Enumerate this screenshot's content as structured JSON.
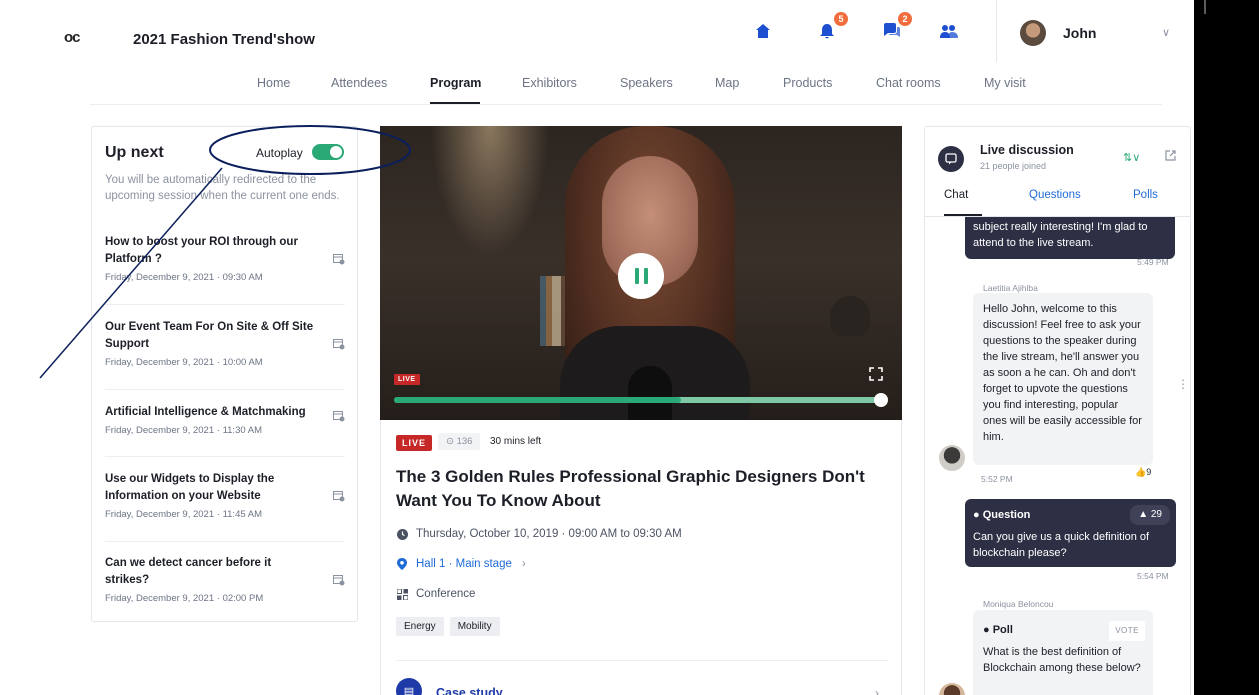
{
  "app": {
    "logo": "oc",
    "event_title": "2021 Fashion Trend'show"
  },
  "header": {
    "icons": [
      {
        "name": "home-icon"
      },
      {
        "name": "bell-icon",
        "badge": "5"
      },
      {
        "name": "chat-icon",
        "badge": "2"
      },
      {
        "name": "people-icon"
      }
    ],
    "user_name": "John"
  },
  "nav": {
    "items": [
      "Home",
      "Attendees",
      "Program",
      "Exhibitors",
      "Speakers",
      "Map",
      "Products",
      "Chat rooms",
      "My visit"
    ],
    "active": "Program"
  },
  "upnext": {
    "title": "Up next",
    "autoplay_label": "Autoplay",
    "autoplay_on": true,
    "description": "You will be automatically redirected to the upcoming session when the current one ends.",
    "sessions": [
      {
        "title": "How to boost your ROI through our Platform ?",
        "date": "Friday, December 9, 2021 · 09:30 AM"
      },
      {
        "title": "Our Event Team For On Site & Off Site Support",
        "date": "Friday, December 9, 2021 · 10:00 AM"
      },
      {
        "title": "Artificial Intelligence & Matchmaking",
        "date": "Friday, December 9, 2021 · 11:30 AM"
      },
      {
        "title": "Use our Widgets to Display the Information on your Website",
        "date": "Friday, December 9, 2021 · 11:45 AM"
      },
      {
        "title": "Can we detect cancer before it strikes?",
        "date": "Friday, December 9, 2021 · 02:00 PM"
      }
    ]
  },
  "video": {
    "live_label": "LIVE",
    "progress": 0.59
  },
  "session": {
    "live_tag": "LIVE",
    "views": "136",
    "time_left": "30 mins left",
    "title": "The 3 Golden Rules Professional Graphic Designers Don't Want You To Know About",
    "datetime": "Thursday, October 10, 2019 · 09:00 AM to 09:30 AM",
    "location": "Hall 1 · Main stage",
    "type": "Conference",
    "tags": [
      "Energy",
      "Mobility"
    ],
    "case_study_label": "Case study"
  },
  "discussion": {
    "title": "Live discussion",
    "subtitle": "21 people joined",
    "tabs": [
      "Chat",
      "Questions",
      "Polls"
    ],
    "active_tab": "Chat",
    "messages": {
      "m1_text": "subject really interesting! I'm glad to attend to the live stream.",
      "m1_time": "5:49 PM",
      "m2_author": "Laetitia Ajihlba",
      "m2_text": "Hello John, welcome to this discussion! Feel free to ask your questions to the speaker during the live stream, he'll answer you as soon a he can. Oh and don't forget to upvote the questions you find interesting, popular ones will be easily accessible for him.",
      "m2_time": "5:52 PM",
      "m2_likes": "9",
      "q_label": "Question",
      "q_count": "29",
      "q_text": "Can you give us a quick definition of blockchain please?",
      "q_time": "5:54 PM",
      "poll_author": "Moniqua Beloncou",
      "poll_label": "Poll",
      "poll_vote": "VOTE",
      "poll_text": "What is the best definition of Blockchain among these below?"
    }
  },
  "colors": {
    "accent_green": "#2aa876",
    "live_red": "#c62828",
    "link_blue": "#1e6bd6",
    "dark_bubble": "#2d2f44",
    "annotation_navy": "#0b1f5c"
  }
}
